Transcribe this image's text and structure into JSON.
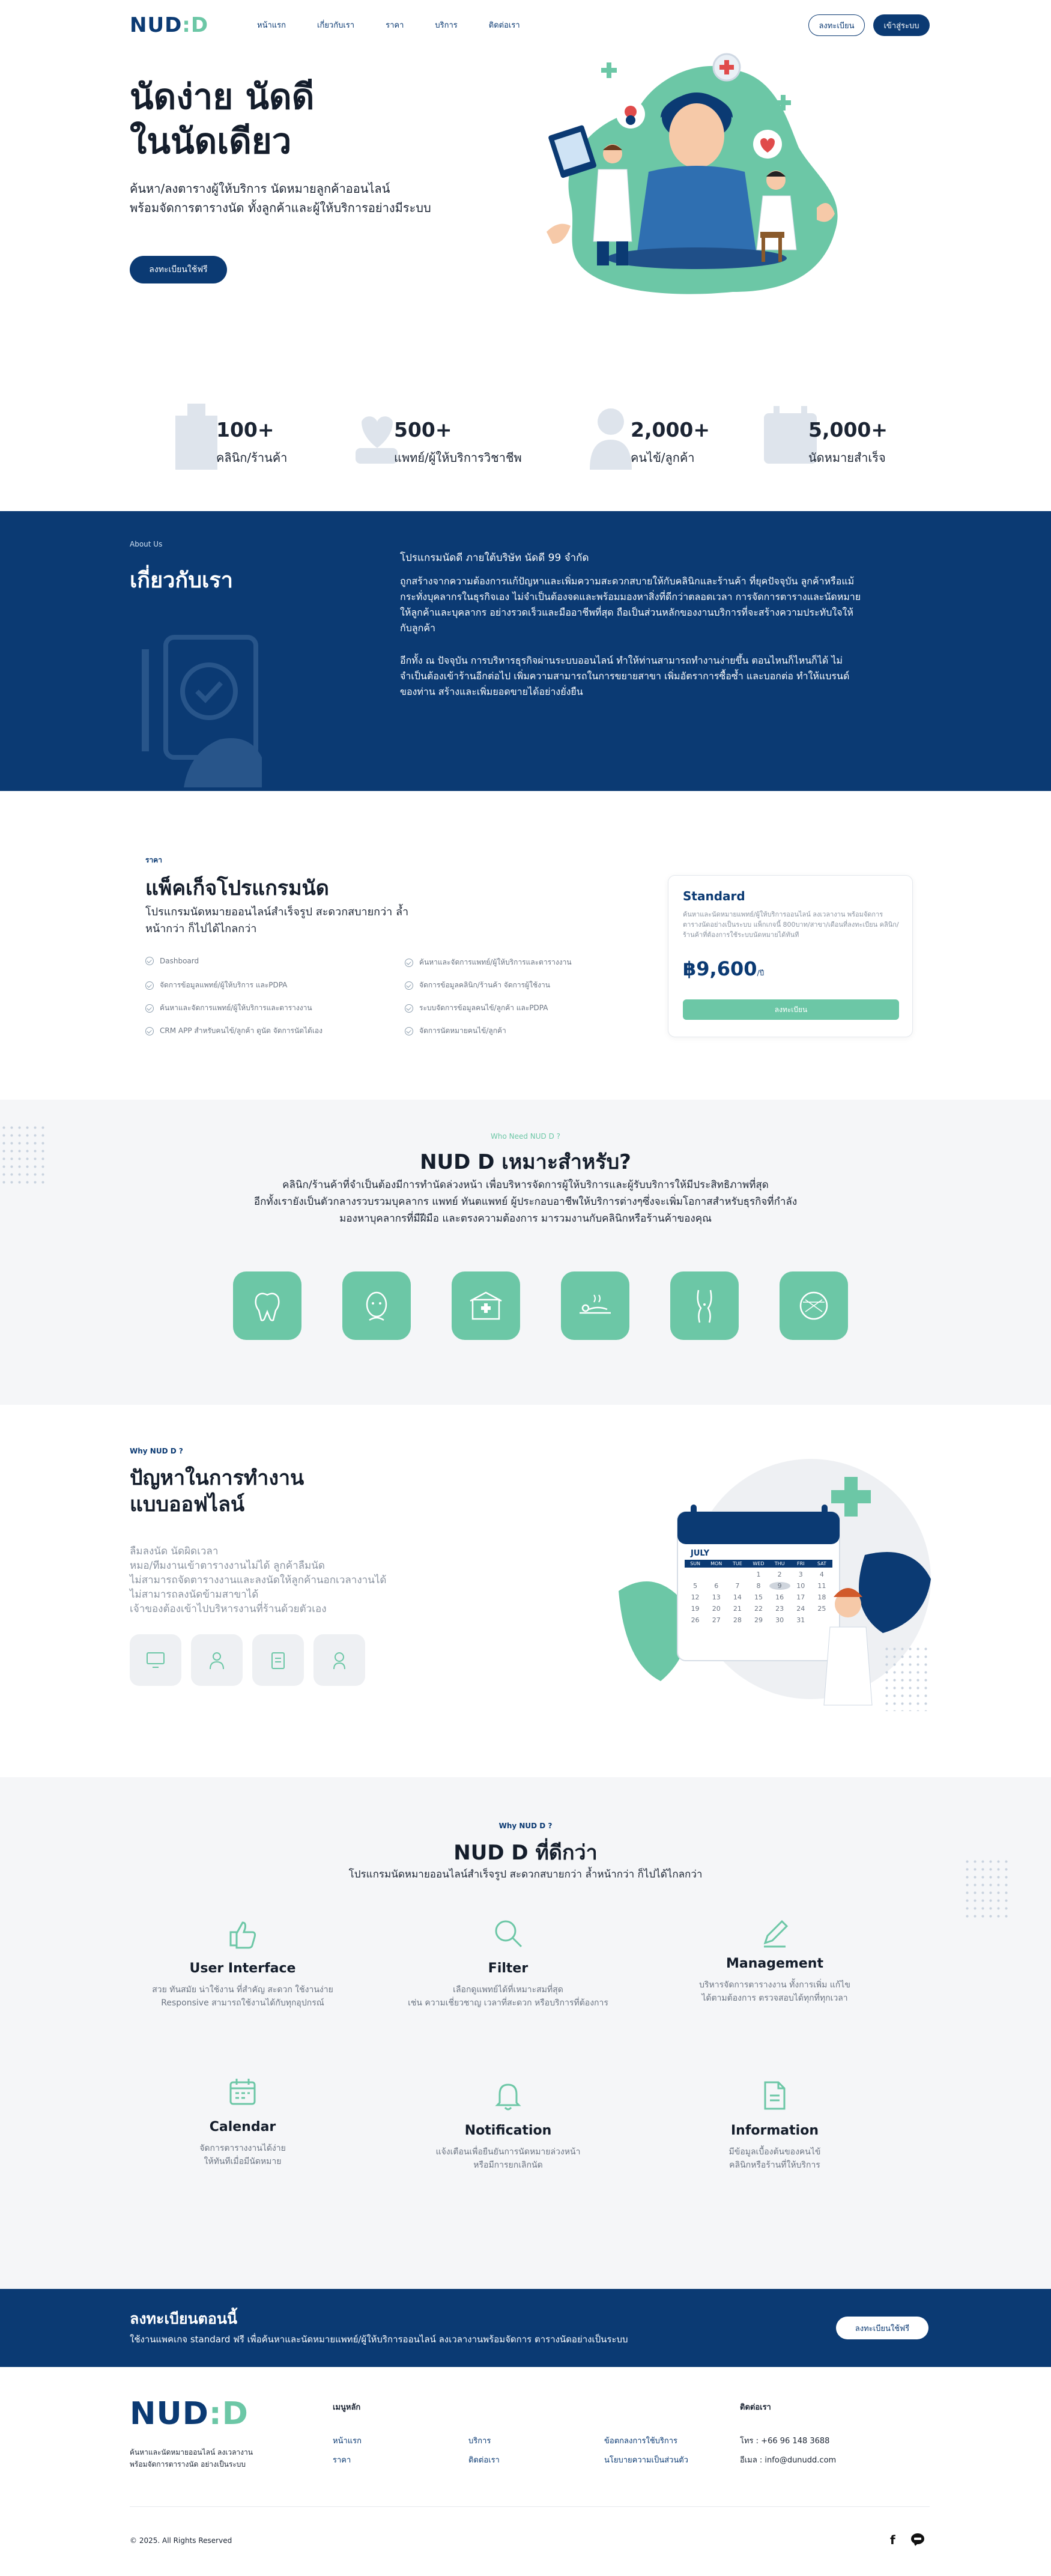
{
  "nav": {
    "logo": "NUD",
    "logo_suffix": "D",
    "links": [
      "หน้าแรก",
      "เกี่ยวกับเรา",
      "ราคา",
      "บริการ",
      "ติดต่อเรา"
    ],
    "register": "ลงทะเบียน",
    "login": "เข้าสู่ระบบ"
  },
  "hero": {
    "title_line1": "นัดง่าย นัดดี",
    "title_line2": "ในนัดเดียว",
    "sub_line1": "ค้นหา/ลงตารางผู้ให้บริการ นัดหมายลูกค้าออนไลน์",
    "sub_line2": "พร้อมจัดการตารางนัด ทั้งลูกค้าและผู้ให้บริการอย่างมีระบบ",
    "cta": "ลงทะเบียนใช้ฟรี"
  },
  "stats": [
    {
      "num": "100+",
      "label": "คลินิก/ร้านค้า"
    },
    {
      "num": "500+",
      "label": "แพทย์/ผู้ให้บริการวิชาชีพ"
    },
    {
      "num": "2,000+",
      "label": "คนไข้/ลูกค้า"
    },
    {
      "num": "5,000+",
      "label": "นัดหมายสำเร็จ"
    }
  ],
  "about": {
    "eyebrow": "About Us",
    "title": "เกี่ยวกับเรา",
    "p1": "โปรแกรมนัดดี ภายใต้บริษัท นัดดี 99 จำกัด",
    "p2": "ถูกสร้างจากความต้องการแก้ปัญหาและเพิ่มความสะดวกสบายให้กับคลินิกและร้านค้า ที่ยุคปัจจุบัน ลูกค้าหรือแม้กระทั่งบุคลากรในธุรกิจเอง ไม่จำเป็นต้องจดและพร้อมมองหาสิ่งที่ดีกว่าตลอดเวลา การจัดการตารางและนัดหมายให้ลูกค้าและบุคลากร อย่างรวดเร็วและมืออาชีพที่สุด ถือเป็นส่วนหลักของงานบริการที่จะสร้างความประทับใจให้กับลูกค้า",
    "p3": "อีกทั้ง ณ ปัจจุบัน การบริหารธุรกิจผ่านระบบออนไลน์ ทำให้ท่านสามารถทำงานง่ายขึ้น ตอนไหนก็ไหนก็ได้ ไม่จำเป็นต้องเข้าร้านอีกต่อไป เพิ่มความสามารถในการขยายสาขา เพิ่มอัตราการซื้อซ้ำ และบอกต่อ ทำให้แบรนด์ของท่าน สร้างและเพิ่มยอดขายได้อย่างยั่งยืน"
  },
  "pricing": {
    "eyebrow": "ราคา",
    "title": "แพ็คเก็จโปรแกรมนัด",
    "sub_line1": "โปรแกรมนัดหมายออนไลน์สำเร็จรูป สะดวกสบายกว่า ล้ำ",
    "sub_line2": "หน้ากว่า ก็ไปได้ไกลกว่า",
    "features_left": [
      "Dashboard",
      "จัดการข้อมูลแพทย์/ผู้ให้บริการ และPDPA",
      "ค้นหาและจัดการแพทย์/ผู้ให้บริการและตารางงาน",
      "CRM APP สำหรับคนไข้/ลูกค้า ดูนัด จัดการนัดได้เอง"
    ],
    "features_right": [
      "ค้นหาและจัดการแพทย์/ผู้ให้บริการและตารางงาน",
      "จัดการข้อมูลคลินิก/ร้านค้า จัดการผู้ใช้งาน",
      "ระบบจัดการข้อมูลคนไข้/ลูกค้า และPDPA",
      "จัดการนัดหมายคนไข้/ลูกค้า"
    ],
    "card": {
      "name": "Standard",
      "desc": "ค้นหาและนัดหมายแพทย์/ผู้ให้บริการออนไลน์ ลงเวลางาน พร้อมจัดการตารางนัดอย่างเป็นระบบ แพ็กเกจนี้ 800บาท/สาขา/เดือนที่ลงทะเบียน คลินิก/ร้านค้าที่ต้องการใช้ระบบนัดหมายได้ทันที",
      "price": "฿9,600",
      "unit": "/ปี",
      "cta": "ลงทะเบียน"
    }
  },
  "who": {
    "eyebrow": "Who Need NUD D ?",
    "title": "NUD D เหมาะสำหรับ?",
    "line1": "คลินิก/ร้านค้าที่จำเป็นต้องมีการทำนัดล่วงหน้า เพื่อบริหารจัดการผู้ให้บริการและผู้รับบริการให้มีประสิทธิภาพที่สุด",
    "line2": "อีกทั้งเรายังเป็นตัวกลางรวบรวมบุคลากร แพทย์ ทันตแพทย์ ผู้ประกอบอาชีพให้บริการต่างๆซึ่งจะเพิ่มโอกาสสำหรับธุรกิจที่กำลัง",
    "line3": "มองหาบุคลากรที่มีฝีมือ และตรงความต้องการ มารวมงานกับคลินิกหรือร้านค้าของคุณ",
    "icons": [
      "tooth-icon",
      "face-treatment-icon",
      "clinic-icon",
      "massage-icon",
      "body-contour-icon",
      "face-analysis-icon"
    ]
  },
  "why": {
    "eyebrow": "Why NUD D ?",
    "title_line1": "ปัญหาในการทำงาน",
    "title_line2": "แบบออฟไลน์",
    "problems": [
      "ลืมลงนัด นัดผิดเวลา",
      "หมอ/ทีมงานเข้าตารางงานไม่ได้ ลูกค้าลืมนัด",
      "ไม่สามารถจัดตารางงานและลงนัดให้ลูกค้านอกเวลางานได้",
      "ไม่สามารถลงนัดข้ามสาขาได้",
      "เจ้าของต้องเข้าไปบริหารงานที่ร้านด้วยตัวเอง"
    ],
    "calendar_month": "JULY",
    "calendar_days": [
      "SUN",
      "MON",
      "TUE",
      "WED",
      "THU",
      "FRI",
      "SAT"
    ],
    "calendar_dates": [
      "",
      "",
      "",
      "1",
      "2",
      "3",
      "4",
      "5",
      "6",
      "7",
      "8",
      "9",
      "10",
      "11",
      "12",
      "13",
      "14",
      "15",
      "16",
      "17",
      "18",
      "19",
      "20",
      "21",
      "22",
      "23",
      "24",
      "25",
      "26",
      "27",
      "28",
      "29",
      "30",
      "31",
      ""
    ]
  },
  "better": {
    "eyebrow": "Why NUD D ?",
    "title": "NUD D ที่ดีกว่า",
    "sub": "โปรแกรมนัดหมายออนไลน์สำเร็จรูป สะดวกสบายกว่า ล้ำหน้ากว่า ก็ไปได้ไกลกว่า",
    "features": [
      {
        "icon": "thumbs-up-icon",
        "title": "User Interface",
        "d1": "สวย ทันสมัย น่าใช้งาน ที่สำคัญ สะดวก ใช้งานง่าย",
        "d2": "Responsive สามารถใช้งานได้กับทุกอุปกรณ์"
      },
      {
        "icon": "search-icon",
        "title": "Filter",
        "d1": "เลือกดูแพทย์ได้ที่เหมาะสมที่สุด",
        "d2": "เช่น ความเชี่ยวชาญ เวลาที่สะดวก หรือบริการที่ต้องการ"
      },
      {
        "icon": "pencil-icon",
        "title": "Management",
        "d1": "บริหารจัดการตารางงาน ทั้งการเพิ่ม แก้ไข",
        "d2": "ได้ตามต้องการ ตรวจสอบได้ทุกที่ทุกเวลา"
      },
      {
        "icon": "calendar-icon",
        "title": "Calendar",
        "d1": "จัดการตารางงานได้ง่าย",
        "d2": "ให้ทันทีเมื่อมีนัดหมาย"
      },
      {
        "icon": "bell-icon",
        "title": "Notification",
        "d1": "แจ้งเตือนเพื่อยืนยันการนัดหมายล่วงหน้า",
        "d2": "หรือมีการยกเลิกนัด"
      },
      {
        "icon": "document-icon",
        "title": "Information",
        "d1": "มีข้อมูลเบื้องต้นของคนไข้",
        "d2": "คลินิกหรือร้านที่ให้บริการ"
      }
    ]
  },
  "signup": {
    "title": "ลงทะเบียนตอนนี้",
    "sub": "ใช้งานแพคเกจ standard ฟรี เพื่อค้นหาและนัดหมายแพทย์/ผู้ให้บริการออนไลน์ ลงเวลางานพร้อมจัดการ ตารางนัดอย่างเป็นระบบ",
    "cta": "ลงทะเบียนใช้ฟรี"
  },
  "footer": {
    "tagline_line1": "ค้นหาและนัดหมายออนไลน์ ลงเวลางาน",
    "tagline_line2": "พร้อมจัดการตารางนัด อย่างเป็นระบบ",
    "menu_title": "เมนูหลัก",
    "menu_col1": [
      "หน้าแรก",
      "ราคา"
    ],
    "menu_col2": [
      "บริการ",
      "ติดต่อเรา"
    ],
    "menu_col3": [
      "ข้อตกลงการใช้บริการ",
      "นโยบายความเป็นส่วนตัว"
    ],
    "contact_title": "ติดต่อเรา",
    "phone": "โทร : +66 96 148 3688",
    "email": "อีเมล : info@dunudd.com",
    "copyright": "© 2025. All Rights Reserved"
  },
  "colors": {
    "navy": "#0b3a73",
    "mint": "#6cc7a6",
    "light": "#f5f6f8"
  }
}
